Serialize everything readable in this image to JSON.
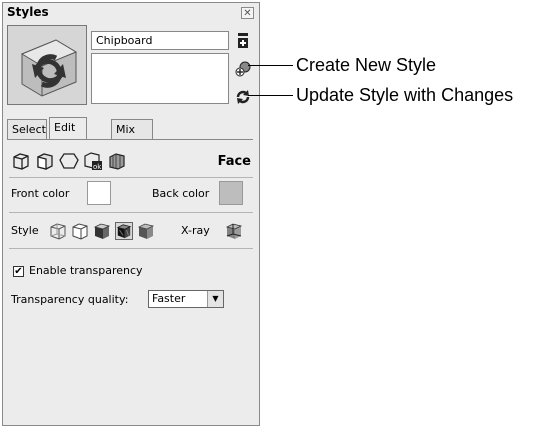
{
  "window": {
    "title": "Styles",
    "close_glyph": "✕"
  },
  "style": {
    "name": "Chipboard",
    "description": ""
  },
  "side_icons": [
    "create-new-style-icon",
    "add-to-model-icon",
    "update-style-icon"
  ],
  "tabs": [
    {
      "label": "Select",
      "active": false
    },
    {
      "label": "Edit",
      "active": true
    },
    {
      "label": "Mix",
      "active": false
    }
  ],
  "edit_section": {
    "icons": [
      "edge-settings-icon",
      "face-settings-icon",
      "background-settings-icon",
      "watermark-settings-icon",
      "modeling-settings-icon"
    ],
    "heading": "Face"
  },
  "face": {
    "front_color_label": "Front color",
    "back_color_label": "Back color",
    "front_color": "#ffffff",
    "back_color": "#bdbdbd",
    "style_label": "Style",
    "style_icons": [
      "wireframe-icon",
      "hidden-line-icon",
      "shaded-icon",
      "shaded-with-textures-icon",
      "monochrome-icon"
    ],
    "xray_label": "X-ray",
    "xray_icon": "xray-icon",
    "enable_transparency_label": "Enable transparency",
    "enable_transparency_checked": true,
    "check_glyph": "✔",
    "transparency_quality_label": "Transparency quality:",
    "transparency_quality_value": "Faster",
    "dropdown_glyph": "▼"
  },
  "callouts": {
    "create_new_style": "Create New Style",
    "update_style": "Update Style with Changes"
  }
}
